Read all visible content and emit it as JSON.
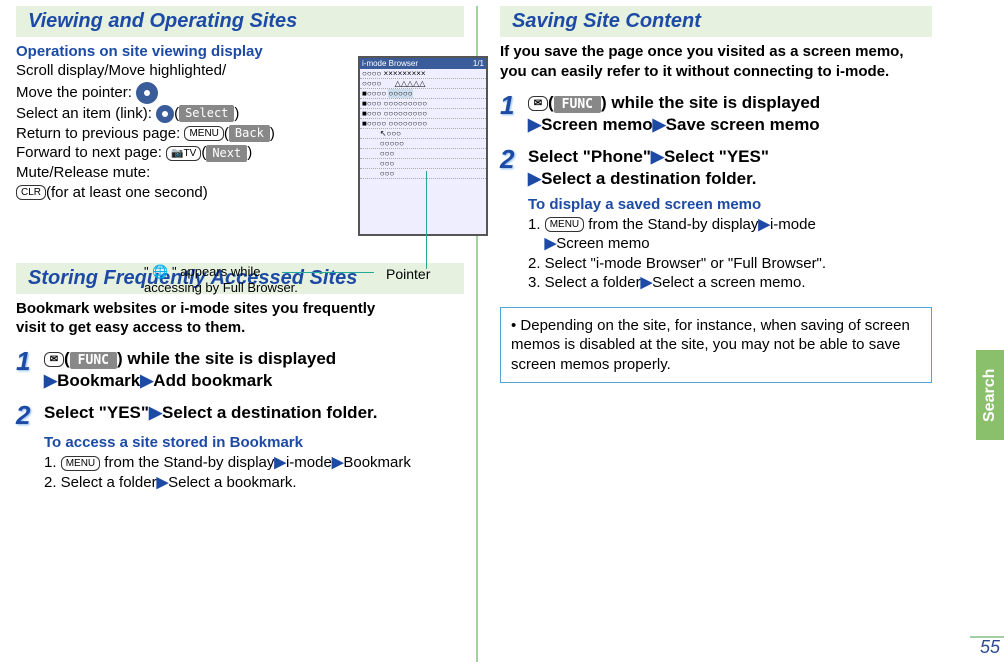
{
  "page_number": "55",
  "side_tab": "Search",
  "left": {
    "section1": {
      "title": "Viewing and Operating Sites",
      "sub": "Operations on site viewing display",
      "scroll": "Scroll display/Move highlighted/",
      "move_pointer": "Move the pointer:",
      "select_item": "Select an item (link):",
      "select_pill": "Select",
      "return_prev": "Return to previous page:",
      "back_pill": "Back",
      "forward_next": "Forward to next page:",
      "next_pill": "Next",
      "mute": "Mute/Release mute:",
      "mute_hold": "(for at least one second)",
      "menu_key": "MENU",
      "tv_key": "📷TV",
      "clr_key": "CLR",
      "mail_key": "✉",
      "fb_note_a": "\" 🌐 \" appears while",
      "fb_note_b": "accessing by Full Browser.",
      "pointer_label": "Pointer",
      "mock_title": "i-mode Browser",
      "mock_page": "1/1"
    },
    "section2": {
      "title": "Storing Frequently Accessed Sites",
      "intro1": "Bookmark websites or i-mode sites you frequently",
      "intro2": "visit to get easy access to them.",
      "step1_a": ") while the site is displayed",
      "step1_b": "Bookmark",
      "step1_c": "Add bookmark",
      "func_pill": "FUNC",
      "step2_a": "Select \"YES\"",
      "step2_b": "Select a destination folder.",
      "sub_title": "To access a site stored in Bookmark",
      "sub1_a": "1. ",
      "sub1_b": " from the Stand-by display",
      "sub1_c": "i-mode",
      "sub1_d": "Bookmark",
      "sub2": "2. Select a folder",
      "sub2_b": "Select a bookmark."
    }
  },
  "right": {
    "section1": {
      "title": "Saving Site Content",
      "intro1": "If you save the page once you visited as a screen memo,",
      "intro2": "you can easily refer to it without connecting to i-mode.",
      "step1_a": ") while the site is displayed",
      "step1_b": "Screen memo",
      "step1_c": "Save screen memo",
      "func_pill": "FUNC",
      "step2_a": "Select \"Phone\"",
      "step2_b": "Select \"YES\"",
      "step2_c": "Select a destination folder.",
      "sub_title": "To display a saved screen memo",
      "sub1_a": "1. ",
      "sub1_b": " from the Stand-by display",
      "sub1_c": "i-mode",
      "sub1_d": "Screen memo",
      "sub2": "2. Select \"i-mode Browser\" or \"Full Browser\".",
      "sub3_a": "3. Select a folder",
      "sub3_b": "Select a screen memo.",
      "note": "• Depending on the site, for instance, when saving of screen memos is disabled at the site, you may not be able to save screen memos properly.",
      "menu_key": "MENU",
      "mail_key": "✉"
    }
  }
}
